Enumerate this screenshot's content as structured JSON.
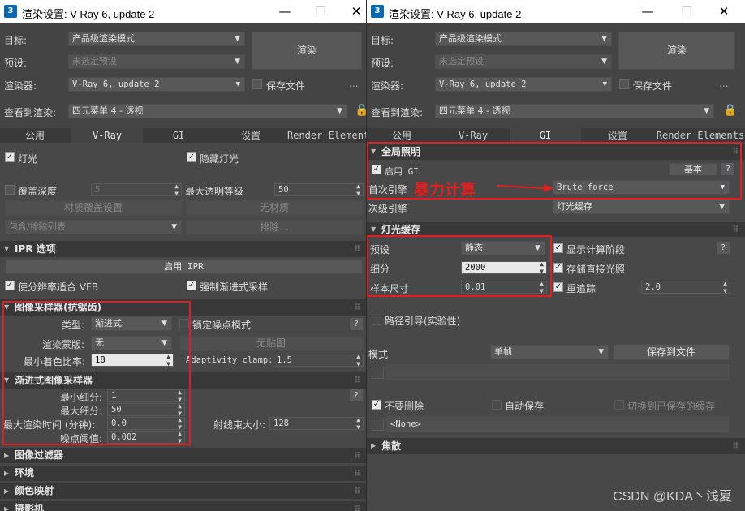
{
  "windows": [
    {
      "title": "渲染设置: V-Ray 6, update 2",
      "app_icon": "3",
      "controls": {
        "minimize": "—",
        "maximize": "☐",
        "close": "✕"
      },
      "rows": {
        "target_label": "目标:",
        "target_value": "产品级渲染模式",
        "preset_label": "预设:",
        "preset_value": "未选定预设",
        "renderer_label": "渲染器:",
        "renderer_value": "V-Ray 6, update 2",
        "save_file_label": "保存文件",
        "more": "...",
        "view_label": "查看到渲染:",
        "view_value": "四元菜单 4 - 透视",
        "render_button": "渲染"
      },
      "tabs": [
        "公用",
        "V-Ray",
        "GI",
        "设置",
        "Render Element"
      ],
      "active_tab": 1,
      "vray": {
        "lights": "灯光",
        "hidden_lights": "隐藏灯光",
        "override_depth": "覆盖深度",
        "override_depth_value": "5",
        "max_transp": "最大透明等级",
        "max_transp_value": "50",
        "material_override": "材质覆盖设置",
        "no_material": "无材质",
        "include_exclude": "包含/排除列表",
        "exclude": "排除...",
        "ipr_title": "IPR 选项",
        "enable_ipr": "启用 IPR",
        "fit_vfb": "使分辨率适合 VFB",
        "force_progressive": "强制渐进式采样",
        "image_sampler_title": "图像采样器(抗锯齿)",
        "type_label": "类型:",
        "type_value": "渐进式",
        "lock_noise": "锁定噪点模式",
        "render_mask_label": "渲染蒙版:",
        "render_mask_value": "无",
        "no_map": "无贴图",
        "min_shading_label": "最小着色比率:",
        "min_shading_value": "18",
        "adaptivity_label": "Adaptivity clamp:",
        "adaptivity_value": "1.5",
        "progressive_title": "渐进式图像采样器",
        "min_subdiv_label": "最小细分:",
        "min_subdiv_value": "1",
        "max_subdiv_label": "最大细分:",
        "max_subdiv_value": "50",
        "max_time_label": "最大渲染时间 (分钟):",
        "max_time_value": "0.0",
        "bundle_label": "射线束大小:",
        "bundle_value": "128",
        "noise_label": "噪点阈值:",
        "noise_value": "0.002",
        "image_filter": "图像过滤器",
        "environment": "环境",
        "color_mapping": "颜色映射",
        "camera": "摄影机"
      }
    },
    {
      "title": "渲染设置: V-Ray 6, update 2",
      "app_icon": "3",
      "controls": {
        "minimize": "—",
        "maximize": "☐",
        "close": "✕"
      },
      "rows": {
        "target_label": "目标:",
        "target_value": "产品级渲染模式",
        "preset_label": "预设:",
        "preset_value": "未选定预设",
        "renderer_label": "渲染器:",
        "renderer_value": "V-Ray 6, update 2",
        "save_file_label": "保存文件",
        "more": "...",
        "view_label": "查看到渲染:",
        "view_value": "四元菜单 4 - 透视",
        "render_button": "渲染"
      },
      "tabs": [
        "公用",
        "V-Ray",
        "GI",
        "设置",
        "Render Elements"
      ],
      "active_tab": 2,
      "gi": {
        "gi_title": "全局照明",
        "enable_gi": "启用 GI",
        "basic": "基本",
        "help": "?",
        "primary_label": "首次引擎",
        "primary_value": "Brute force",
        "annotation": "暴力计算",
        "secondary_label": "次级引擎",
        "secondary_value": "灯光缓存",
        "light_cache_title": "灯光缓存",
        "preset_label": "预设",
        "preset_value": "静态",
        "show_calc": "显示计算阶段",
        "subdiv_label": "细分",
        "subdiv_value": "2000",
        "store_direct": "存储直接光照",
        "sample_size_label": "样本尺寸",
        "sample_size_value": "0.01",
        "retrace": "重追踪",
        "retrace_value": "2.0",
        "path_guiding": "路径引导(实验性)",
        "mode_label": "模式",
        "mode_value": "单帧",
        "save_to_file": "保存到文件",
        "dont_delete": "不要删除",
        "auto_save": "自动保存",
        "switch_saved": "切换到已保存的缓存",
        "none_file": "<None>",
        "caustics": "焦散"
      }
    }
  ],
  "watermark": "CSDN @KDA丶浅夏",
  "colors": {
    "highlight_box": "#e02020",
    "annotation": "#e02020"
  }
}
